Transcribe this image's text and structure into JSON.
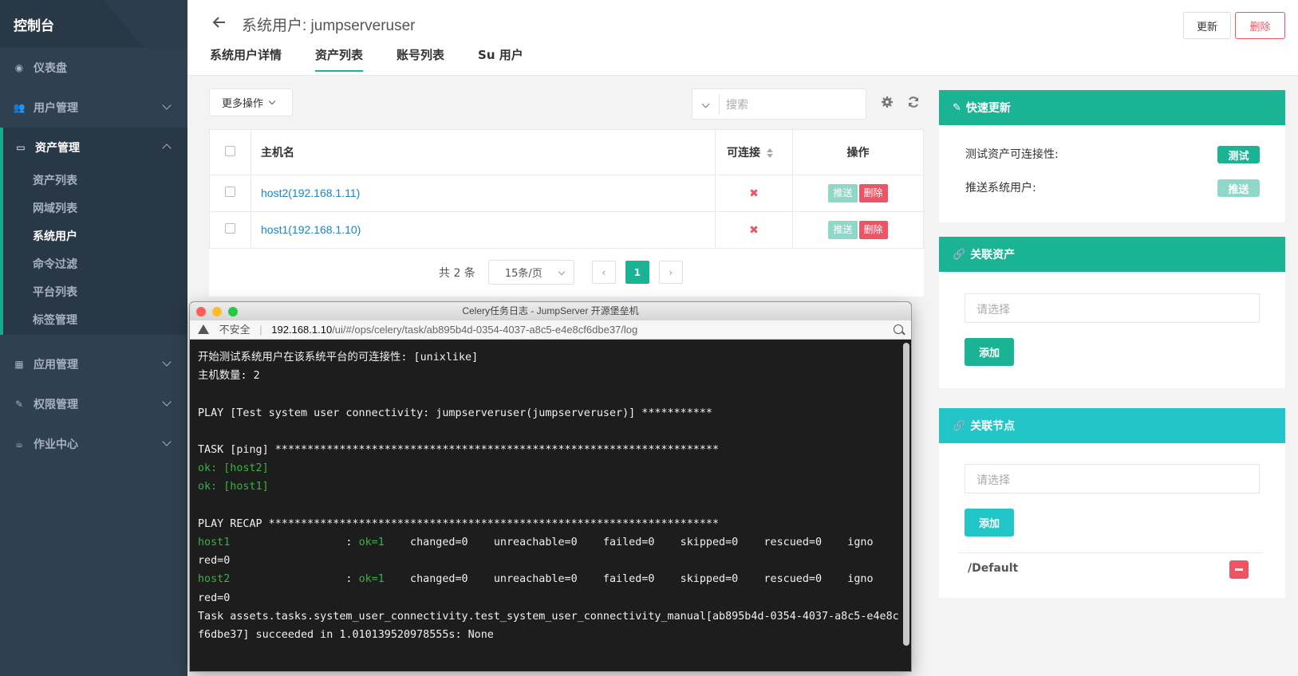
{
  "sidebar": {
    "brand": "控制台",
    "items": [
      {
        "label": "仪表盘"
      },
      {
        "label": "用户管理"
      },
      {
        "label": "资产管理"
      },
      {
        "label": "应用管理"
      },
      {
        "label": "权限管理"
      },
      {
        "label": "作业中心"
      }
    ],
    "sub_items": [
      "资产列表",
      "网域列表",
      "系统用户",
      "命令过滤",
      "平台列表",
      "标签管理"
    ],
    "active_sub": "系统用户"
  },
  "header": {
    "title": "系统用户: jumpserveruser",
    "tabs": [
      "系统用户详情",
      "资产列表",
      "账号列表",
      "Su 用户"
    ],
    "active_tab": "资产列表",
    "update_label": "更新",
    "delete_label": "删除"
  },
  "toolbar": {
    "more_actions": "更多操作",
    "search_placeholder": "搜索"
  },
  "table": {
    "columns": [
      "主机名",
      "可连接",
      "操作"
    ],
    "rows": [
      {
        "host": "host2(192.168.1.11)",
        "connectable": "✖",
        "push": "推送",
        "delete": "删除"
      },
      {
        "host": "host1(192.168.1.10)",
        "connectable": "✖",
        "push": "推送",
        "delete": "删除"
      }
    ]
  },
  "pagination": {
    "total": "共 2 条",
    "page_size": "15条/页",
    "current_page": "1",
    "prev": "‹",
    "next": "›"
  },
  "quick_update": {
    "title": "快速更新",
    "test_label": "测试资产可连接性:",
    "test_button": "测试",
    "push_label": "推送系统用户:",
    "push_button": "推送"
  },
  "linked_assets": {
    "title": "关联资产",
    "placeholder": "请选择",
    "add_button": "添加"
  },
  "linked_nodes": {
    "title": "关联节点",
    "placeholder": "请选择",
    "add_button": "添加",
    "nodes": [
      "/Default"
    ]
  },
  "popup": {
    "window_title": "Celery任务日志 - JumpServer 开源堡垒机",
    "insecure": "不安全",
    "url_host": "192.168.1.10",
    "url_path": "/ui/#/ops/celery/task/ab895b4d-0354-4037-a8c5-e4e8cf6dbe37/log",
    "log": {
      "l1": "开始测试系统用户在该系统平台的可连接性: [unixlike]",
      "l2": "主机数量: 2",
      "l3": "PLAY [Test system user connectivity: jumpserveruser(jumpserveruser)] ***********",
      "l4": "TASK [ping] *********************************************************************",
      "l5": "ok: [host2]",
      "l6": "ok: [host1]",
      "l7": "PLAY RECAP **********************************************************************",
      "r1_host": "host1",
      "r1_colon": "                  : ",
      "r1_ok": "ok=1",
      "r1_rest": "    changed=0    unreachable=0    failed=0    skipped=0    rescued=0    igno",
      "r1_wrap": "red=0",
      "r2_host": "host2",
      "r2_colon": "                  : ",
      "r2_ok": "ok=1",
      "r2_rest": "    changed=0    unreachable=0    failed=0    skipped=0    rescued=0    igno",
      "r2_wrap": "red=0",
      "l8": "Task assets.tasks.system_user_connectivity.test_system_user_connectivity_manual[ab895b4d-0354-4037-a8c5-e4e8c",
      "l9": "f6dbe37] succeeded in 1.010139520978555s: None"
    }
  },
  "colors": {
    "sidebar_bg": "#2f4050",
    "accent_green": "#1ab394",
    "accent_cyan": "#23c6c8",
    "danger": "#ed5565",
    "link": "#1c84c6"
  }
}
